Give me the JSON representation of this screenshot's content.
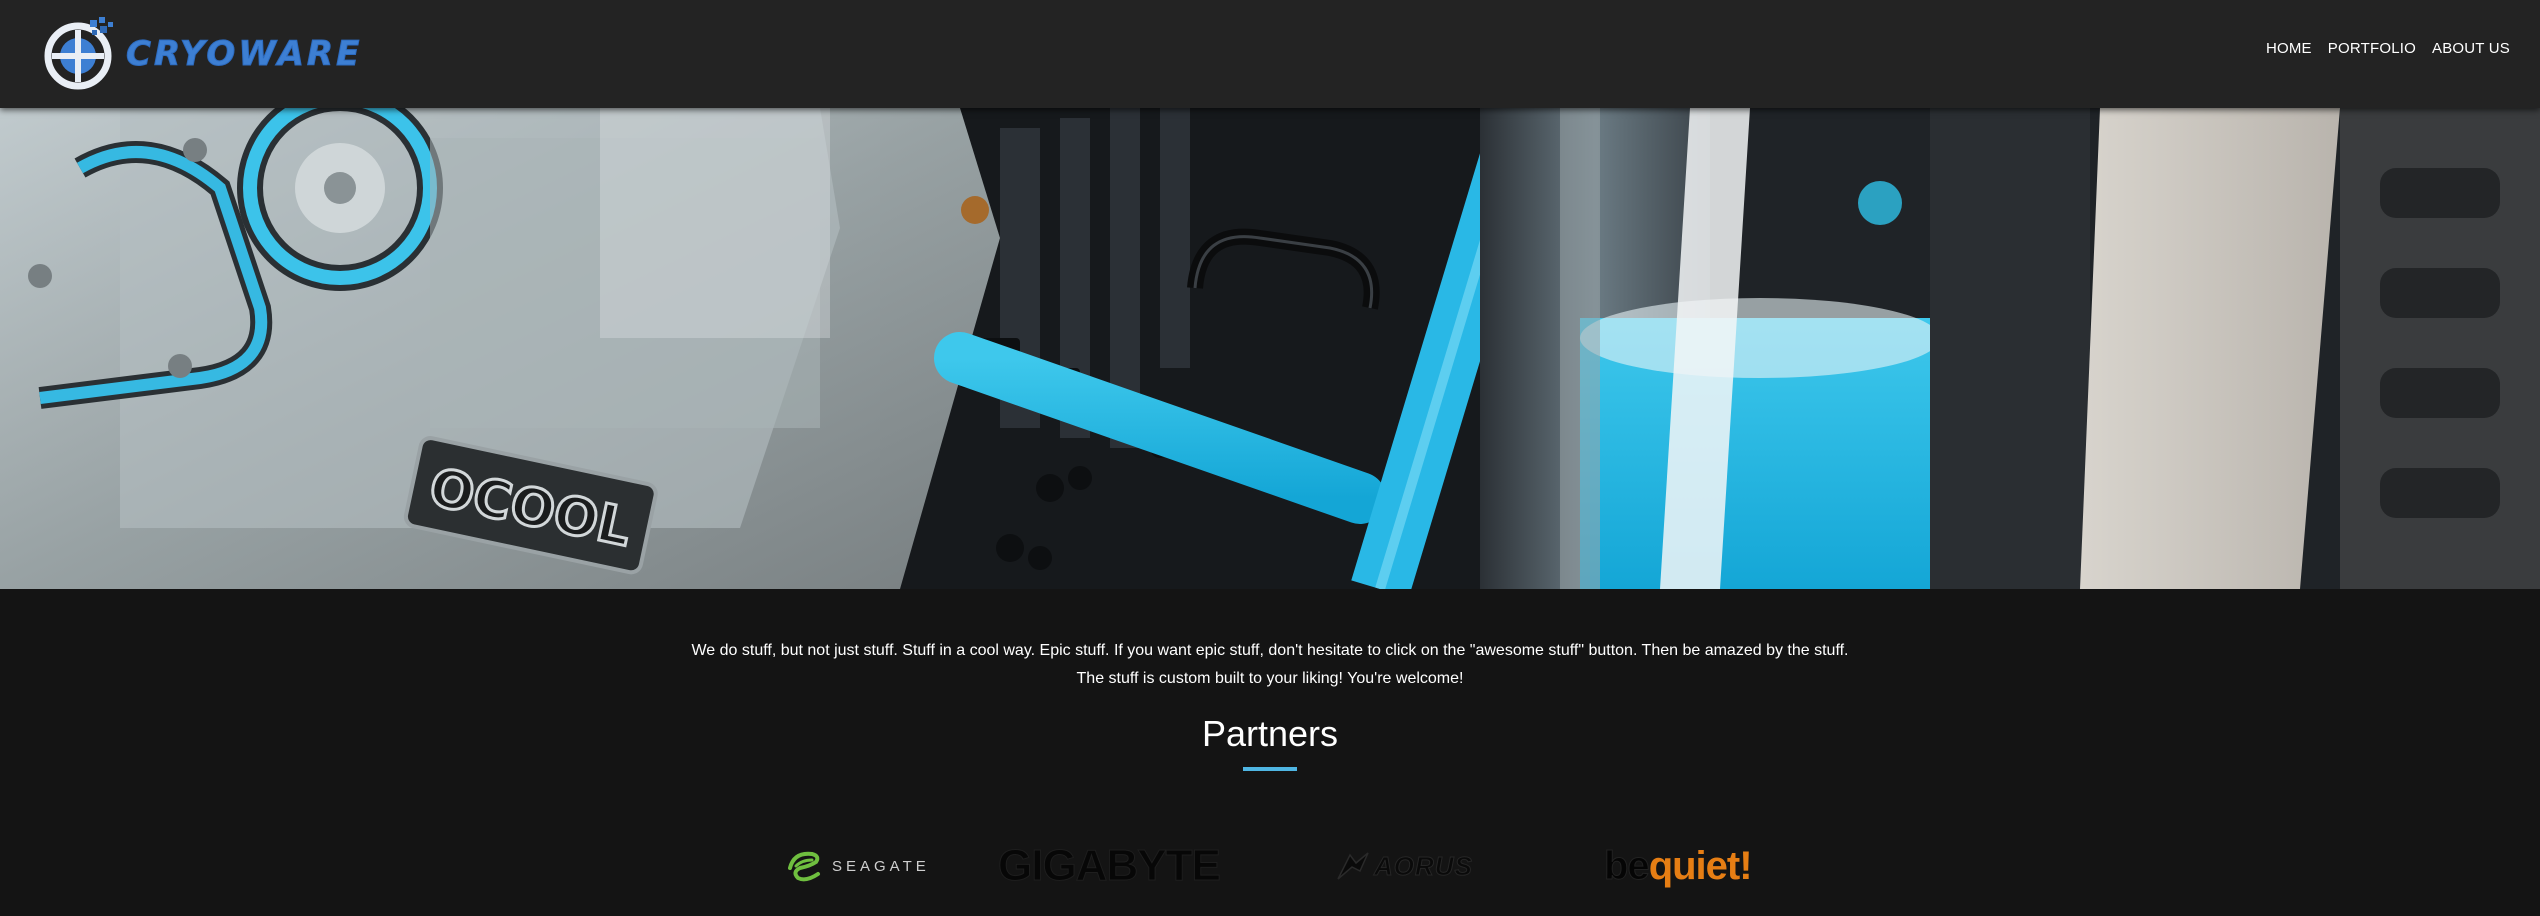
{
  "brand": {
    "name": "CRYOWARE",
    "color": "#3d7fd3"
  },
  "nav": {
    "items": [
      {
        "label": "HOME"
      },
      {
        "label": "PORTFOLIO"
      },
      {
        "label": "ABOUT US"
      }
    ]
  },
  "hero": {
    "image_text": "OCOOL"
  },
  "intro": {
    "text": "We do stuff, but not just stuff. Stuff in a cool way. Epic stuff. If you want epic stuff, don't hesitate to click on the \"awesome stuff\" button. Then be amazed by the stuff. The stuff is custom built to your liking! You're welcome!"
  },
  "partners": {
    "title": "Partners",
    "accent_color": "#4fb6e3",
    "logos": [
      {
        "name": "SEAGATE"
      },
      {
        "name": "GIGABYTE"
      },
      {
        "name": "AORUS"
      },
      {
        "be": "be",
        "quiet": "quiet!"
      }
    ]
  }
}
